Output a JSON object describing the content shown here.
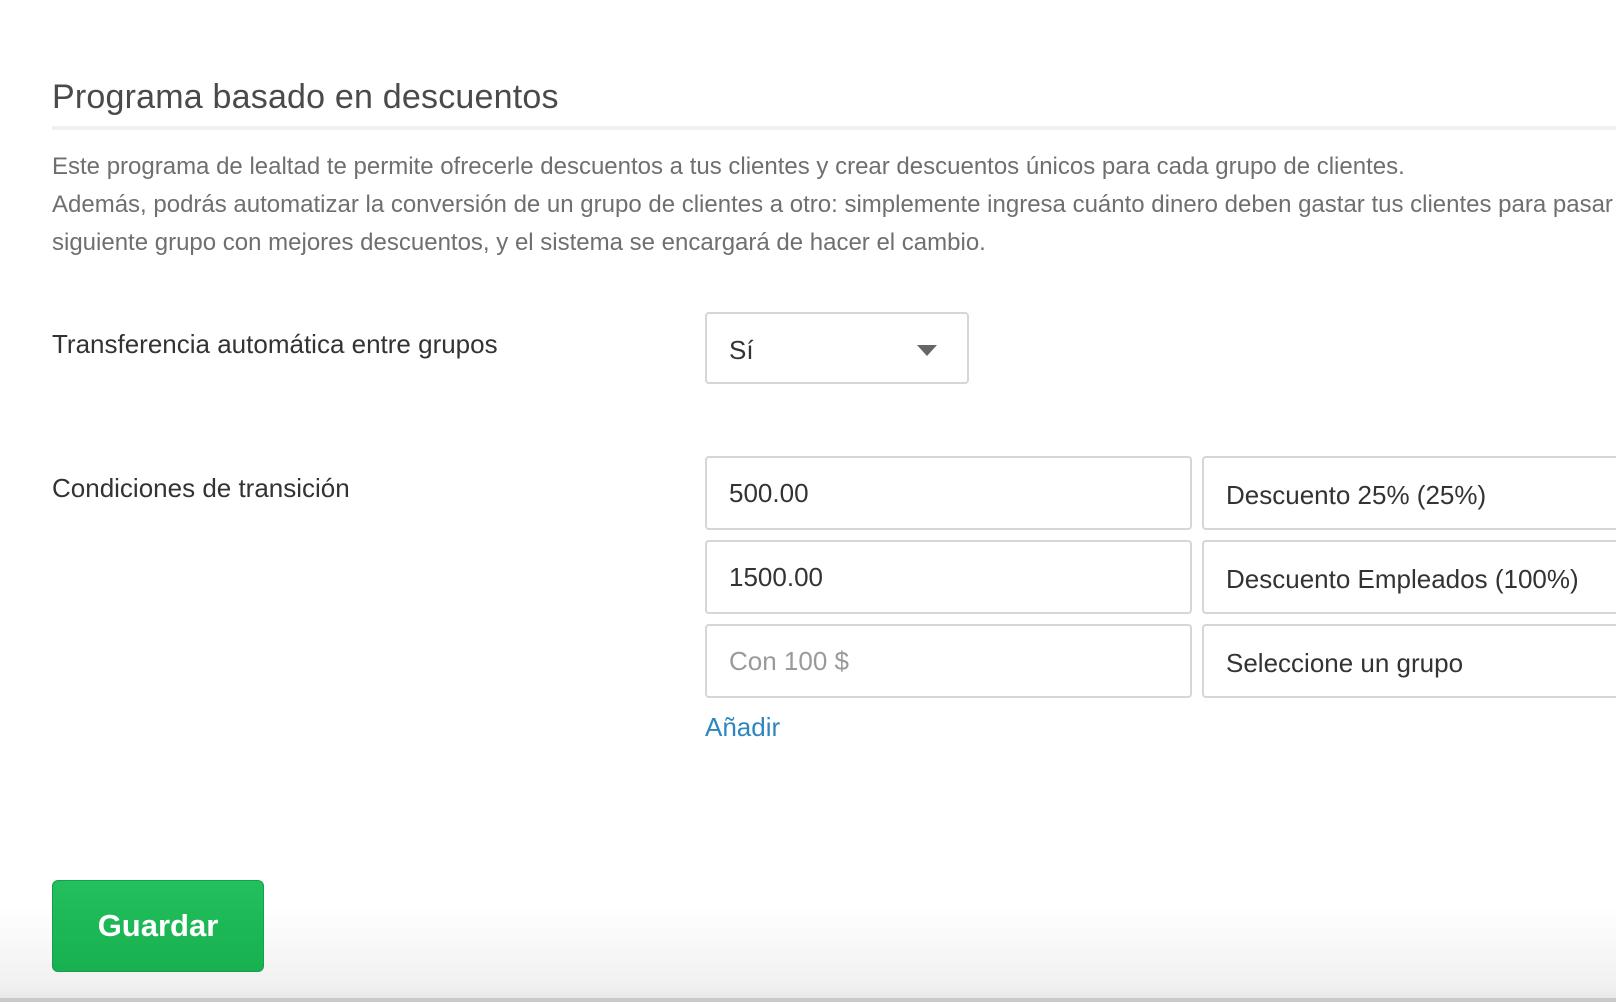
{
  "section": {
    "title": "Programa basado en descuentos",
    "description": [
      "Este programa de lealtad te permite ofrecerle descuentos a tus clientes y crear descuentos únicos para cada grupo de clientes.",
      "Además, podrás automatizar la conversión de un grupo de clientes a otro: simplemente ingresa cuánto dinero deben gastar tus clientes para pasar al",
      "siguiente grupo con mejores descuentos, y el sistema se encargará de hacer el cambio."
    ]
  },
  "auto_transfer": {
    "label": "Transferencia automática entre grupos",
    "selected_value": "Sí"
  },
  "conditions": {
    "label": "Condiciones de transición",
    "rows": [
      {
        "amount": "500.00",
        "amount_placeholder": "",
        "group": "Descuento 25% (25%)"
      },
      {
        "amount": "1500.00",
        "amount_placeholder": "",
        "group": "Descuento Empleados (100%)"
      },
      {
        "amount": "",
        "amount_placeholder": "Con 100 $",
        "group": "Seleccione un grupo"
      }
    ],
    "add_label": "Añadir"
  },
  "actions": {
    "save_label": "Guardar"
  },
  "colors": {
    "save_button": "#1db954",
    "link": "#2e86c1",
    "border": "#d6d6d6"
  }
}
